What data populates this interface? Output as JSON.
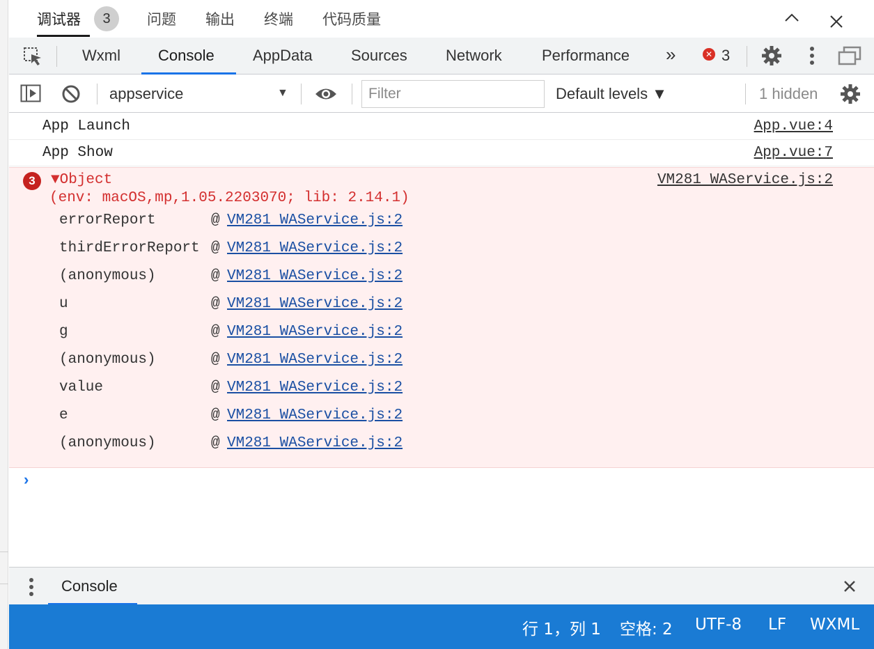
{
  "top_tabs": [
    {
      "label": "调试器"
    },
    {
      "label": "问题"
    },
    {
      "label": "输出"
    },
    {
      "label": "终端"
    },
    {
      "label": "代码质量"
    }
  ],
  "debugger_badge": "3",
  "panel_tabs": [
    "Wxml",
    "Console",
    "AppData",
    "Sources",
    "Network",
    "Performance"
  ],
  "more_tabs_label": "»",
  "error_count": "3",
  "console_toolbar": {
    "context": "appservice",
    "filter_placeholder": "Filter",
    "levels": "Default levels ▼",
    "hidden": "1 hidden"
  },
  "log": {
    "plain_messages": [
      {
        "text": "App Launch",
        "source": "App.vue:4"
      },
      {
        "text": "App Show",
        "source": "App.vue:7"
      }
    ],
    "error": {
      "count_badge": "3",
      "summary": "▼Object",
      "detail": "(env: macOS,mp,1.05.2203070; lib: 2.14.1)",
      "source": "VM281 WAService.js:2",
      "stack": [
        {
          "fn": "errorReport",
          "at": "@",
          "link": "VM281 WAService.js:2"
        },
        {
          "fn": "thirdErrorReport",
          "at": "@",
          "link": "VM281 WAService.js:2"
        },
        {
          "fn": "(anonymous)",
          "at": "@",
          "link": "VM281 WAService.js:2"
        },
        {
          "fn": "u",
          "at": "@",
          "link": "VM281 WAService.js:2"
        },
        {
          "fn": "g",
          "at": "@",
          "link": "VM281 WAService.js:2"
        },
        {
          "fn": "(anonymous)",
          "at": "@",
          "link": "VM281 WAService.js:2"
        },
        {
          "fn": "value",
          "at": "@",
          "link": "VM281 WAService.js:2"
        },
        {
          "fn": "e",
          "at": "@",
          "link": "VM281 WAService.js:2"
        },
        {
          "fn": "(anonymous)",
          "at": "@",
          "link": "VM281 WAService.js:2"
        }
      ]
    },
    "prompt": "›"
  },
  "drawer": {
    "tab": "Console"
  },
  "status_bar": {
    "position": "行 1，列 1",
    "spaces": "空格: 2",
    "encoding": "UTF-8",
    "eol": "LF",
    "language": "WXML"
  },
  "colors": {
    "accent": "#1a73e8",
    "status_bar": "#1a7bd4",
    "error_bg": "#fff0f0",
    "error_text": "#d32f2f",
    "link": "#1a4fa3"
  },
  "icons": [
    "inspect-element-icon",
    "chevron-up-icon",
    "close-icon",
    "error-icon",
    "settings-icon",
    "kebab-menu-icon",
    "undock-icon",
    "sidebar-toggle-icon",
    "clear-console-icon",
    "dropdown-arrow-icon",
    "eye-icon",
    "prompt-chevron-icon"
  ]
}
